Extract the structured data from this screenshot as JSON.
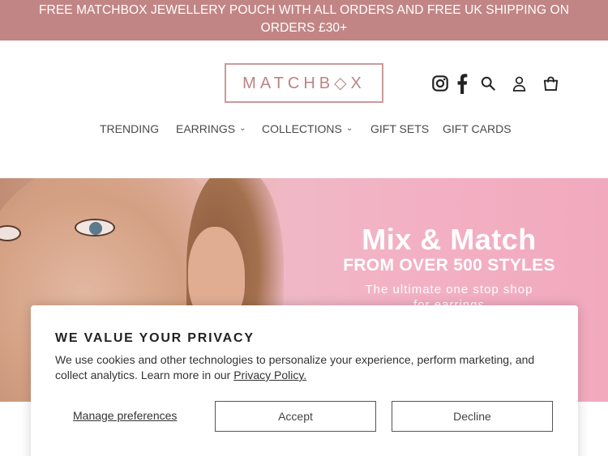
{
  "announcement": {
    "line1": "FREE MATCHBOX JEWELLERY POUCH WITH ALL ORDERS AND FREE UK SHIPPING ON",
    "line2": "ORDERS £30+"
  },
  "header": {
    "logo_text": "MATCHB◇X",
    "icons": [
      "instagram-icon",
      "facebook-icon",
      "search-icon",
      "user-icon",
      "cart-icon"
    ]
  },
  "nav": {
    "items": [
      {
        "label": "TRENDING",
        "has_dropdown": false
      },
      {
        "label": "EARRINGS",
        "has_dropdown": true
      },
      {
        "label": "COLLECTIONS",
        "has_dropdown": true
      },
      {
        "label": "GIFT SETS",
        "has_dropdown": false
      },
      {
        "label": "GIFT CARDS",
        "has_dropdown": false
      }
    ]
  },
  "hero": {
    "headline": "Mix & Match",
    "subheadline": "FROM OVER 500 STYLES",
    "tagline_line1": "The ultimate one stop shop",
    "tagline_line2": "for earrings"
  },
  "cookie_banner": {
    "title": "WE VALUE YOUR PRIVACY",
    "text": "We use cookies and other technologies to personalize your experience, perform marketing, and collect analytics. Learn more in our ",
    "link_text": "Privacy Policy.",
    "manage_label": "Manage preferences",
    "accept_label": "Accept",
    "decline_label": "Decline"
  },
  "colors": {
    "announcement_bg": "#c28585",
    "logo_pink": "#b98486",
    "hero_pink": "#f3b0c4"
  }
}
